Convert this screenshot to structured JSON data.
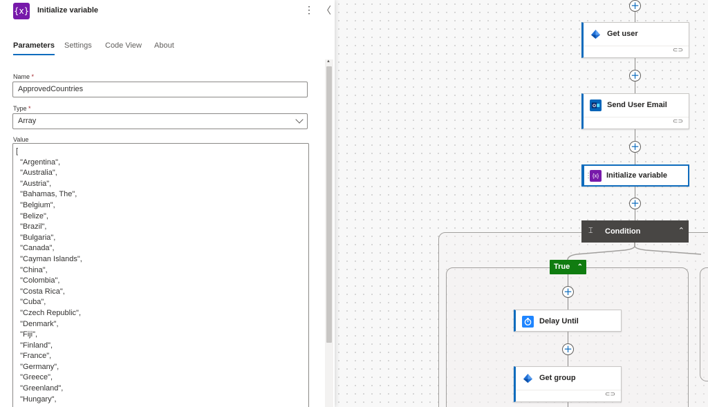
{
  "panel": {
    "title": "Initialize variable",
    "header_icon": "{x}",
    "more_glyph": "⋮",
    "collapse_glyph": "〈",
    "tabs": [
      {
        "label": "Parameters",
        "active": true
      },
      {
        "label": "Settings",
        "active": false
      },
      {
        "label": "Code View",
        "active": false
      },
      {
        "label": "About",
        "active": false
      }
    ],
    "name_label": "Name",
    "name_value": "ApprovedCountries",
    "type_label": "Type",
    "type_value": "Array",
    "required_mark": "*",
    "value_label": "Value",
    "value_lines": [
      "[",
      "  \"Argentina\",",
      "  \"Australia\",",
      "  \"Austria\",",
      "  \"Bahamas, The\",",
      "  \"Belgium\",",
      "  \"Belize\",",
      "  \"Brazil\",",
      "  \"Bulgaria\",",
      "  \"Canada\",",
      "  \"Cayman Islands\",",
      "  \"China\",",
      "  \"Colombia\",",
      "  \"Costa Rica\",",
      "  \"Cuba\",",
      "  \"Czech Republic\",",
      "  \"Denmark\",",
      "  \"Fiji\",",
      "  \"Finland\",",
      "  \"France\",",
      "  \"Germany\",",
      "  \"Greece\",",
      "  \"Greenland\",",
      "  \"Hungary\","
    ]
  },
  "flow": {
    "get_user": "Get user",
    "send_user_email": "Send User Email",
    "initialize_variable": "Initialize variable",
    "variable_icon": "{x}",
    "condition": "Condition",
    "condition_icon": "⌶",
    "true_branch": "True",
    "delay_until": "Delay Until",
    "get_group": "Get group",
    "plus_glyph": "+",
    "link_glyph": "⊂⊃",
    "chevron_up": "⌃"
  },
  "colors": {
    "variable_purple": "#7719aa",
    "accent_blue": "#0f6cbd",
    "condition_dark": "#484644",
    "true_green": "#107c10",
    "outlook_blue": "#0364b8",
    "entra_blue": "#1f6fd6"
  },
  "icons": {
    "header": "variable-icon",
    "more": "more-vertical-icon",
    "collapse": "chevron-left-icon",
    "select": "chevron-down-icon",
    "get_user": "entra-id-icon",
    "send_email": "outlook-icon",
    "delay": "timer-icon",
    "condition": "condition-icon"
  }
}
